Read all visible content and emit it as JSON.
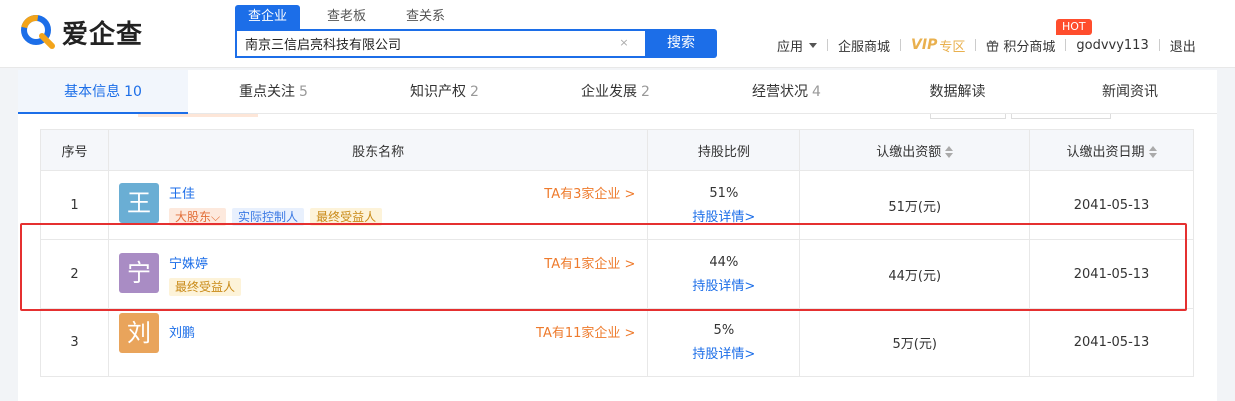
{
  "header": {
    "logo_text": "爱企查",
    "search_tabs": [
      "查企业",
      "查老板",
      "查关系"
    ],
    "search_value": "南京三信启亮科技有限公司",
    "search_button": "搜索",
    "nav": {
      "apps": "应用",
      "mall": "企服商城",
      "vip": "VIP",
      "vip_zone": "专区",
      "points": "积分商城",
      "hot": "HOT",
      "user": "godvvy113",
      "logout": "退出"
    }
  },
  "tabs": [
    {
      "label": "基本信息",
      "count": "10"
    },
    {
      "label": "重点关注",
      "count": "5"
    },
    {
      "label": "知识产权",
      "count": "2"
    },
    {
      "label": "企业发展",
      "count": "2"
    },
    {
      "label": "经营状况",
      "count": "4"
    },
    {
      "label": "数据解读",
      "count": ""
    },
    {
      "label": "新闻资讯",
      "count": ""
    }
  ],
  "table": {
    "headers": {
      "index": "序号",
      "name": "股东名称",
      "ratio": "持股比例",
      "capital": "认缴出资额",
      "date": "认缴出资日期"
    },
    "detail_link": "持股详情>",
    "rows": [
      {
        "index": "1",
        "avatar": "王",
        "avatar_color": "#6aaed4",
        "name": "王佳",
        "companies": "TA有3家企业 >",
        "tags": [
          {
            "text": "大股东⌵",
            "style": "orange"
          },
          {
            "text": "实际控制人",
            "style": "blue"
          },
          {
            "text": "最终受益人",
            "style": "gold"
          }
        ],
        "ratio": "51%",
        "capital": "51万(元)",
        "date": "2041-05-13"
      },
      {
        "index": "2",
        "avatar": "宁",
        "avatar_color": "#a98cc4",
        "name": "宁姝婷",
        "companies": "TA有1家企业 >",
        "tags": [
          {
            "text": "最终受益人",
            "style": "gold"
          }
        ],
        "ratio": "44%",
        "capital": "44万(元)",
        "date": "2041-05-13"
      },
      {
        "index": "3",
        "avatar": "刘",
        "avatar_color": "#e9a45b",
        "name": "刘鹏",
        "companies": "TA有11家企业 >",
        "tags": [],
        "ratio": "5%",
        "capital": "5万(元)",
        "date": "2041-05-13"
      }
    ]
  },
  "colors": {
    "brand": "#1c6ee8",
    "accent_orange": "#ee7b2d",
    "highlight_red": "#e53030"
  }
}
